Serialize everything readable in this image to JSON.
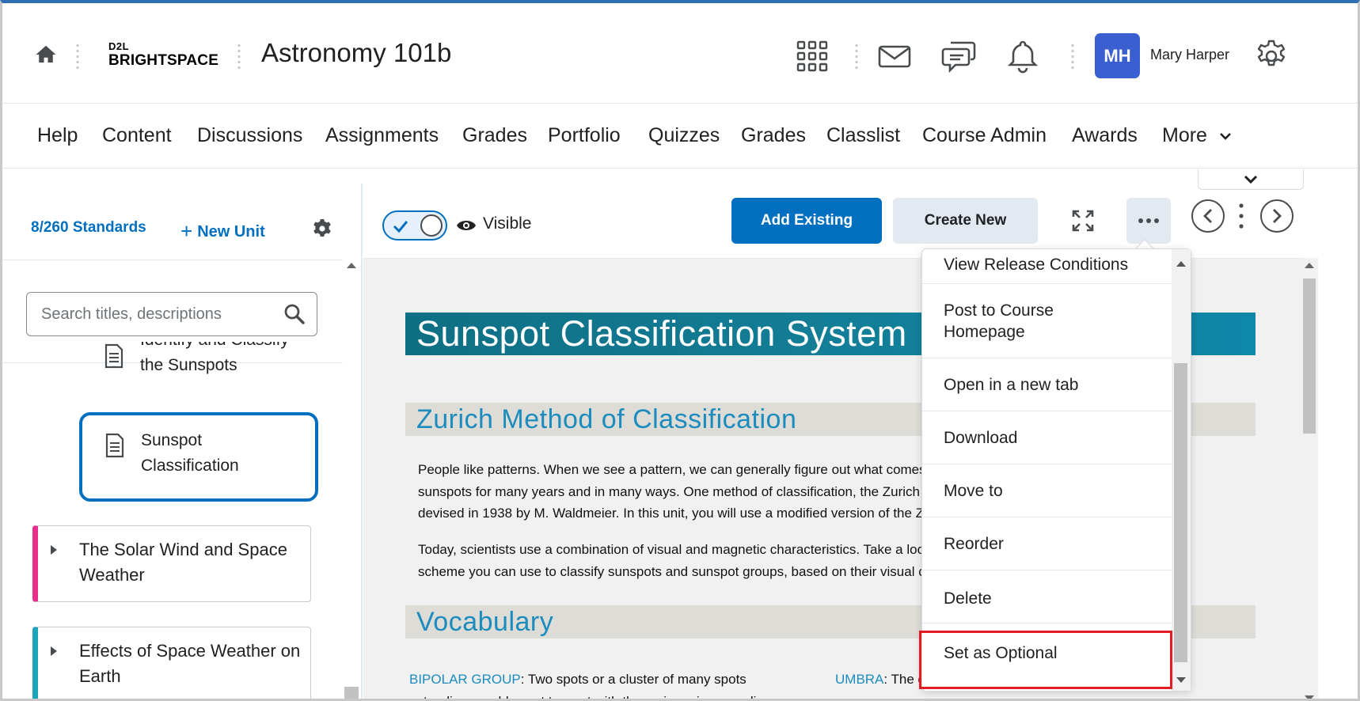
{
  "header": {
    "logo_top": "D2L",
    "logo_bottom": "BRIGHTSPACE",
    "course_title": "Astronomy 101b",
    "user_initials": "MH",
    "user_name": "Mary Harper"
  },
  "nav": {
    "items": [
      "Help",
      "Content",
      "Discussions",
      "Assignments",
      "Grades",
      "Portfolio",
      "Quizzes",
      "Grades",
      "Classlist",
      "Course Admin",
      "Awards",
      "More"
    ]
  },
  "left_panel": {
    "standards_link": "8/260 Standards",
    "new_unit_label": "New Unit",
    "search_placeholder": "Search titles, descriptions",
    "partial_topic_line1": "Identify and Classify",
    "partial_topic_line2": "the Sunspots",
    "selected_topic_line1": "Sunspot",
    "selected_topic_line2": "Classification",
    "units": [
      {
        "line1": "The Solar Wind and Space",
        "line2": "Weather",
        "color": "#e82f8e"
      },
      {
        "line1": "Effects of Space Weather on",
        "line2": "Earth",
        "color": "#1aa5b8"
      }
    ]
  },
  "toolbar": {
    "visible_label": "Visible",
    "add_existing_label": "Add Existing",
    "create_new_label": "Create New"
  },
  "content": {
    "page_title": "Sunspot Classification System",
    "section1_title": "Zurich Method of Classification",
    "para1_line1": "People like patterns. When we see a pattern, we can generally figure out what comes next. Scientists have been classifying",
    "para1_line2": "sunspots for many years and in many ways. One method of classification, the Zurich Method of Classification, was",
    "para1_line3": "devised in 1938 by M. Waldmeier. In this unit, you will use a modified version of the Zurich classification system.",
    "para2_line1": "Today, scientists use a combination of visual and magnetic characteristics. Take a look at this modified classification",
    "para2_line2": "scheme you can use to classify sunspots and sunspot groups, based on their visual characteristics.",
    "section2_title": "Vocabulary",
    "vocab_term1": "BIPOLAR GROUP",
    "vocab_def1_line1": ": Two spots or a cluster of many spots",
    "vocab_def1_line2": "extending roughly east to west with the major axis exceeding a",
    "vocab_term2": "UMBRA",
    "vocab_def2_line1": ": The dark center of a sunspot"
  },
  "dropdown": {
    "items": [
      "View Release Conditions",
      "Post to Course Homepage",
      "Open in a new tab",
      "Download",
      "Move to",
      "Reorder",
      "Delete",
      "Set as Optional"
    ]
  },
  "colors": {
    "accent": "#006fbf",
    "highlight": "#e31b23",
    "title_bar": "#137e97"
  }
}
